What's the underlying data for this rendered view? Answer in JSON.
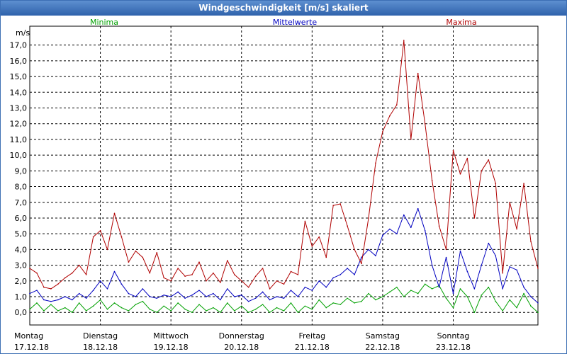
{
  "chart_data": {
    "type": "line",
    "title": "Windgeschwindigkeit [m/s] skaliert",
    "ylabel": "m/s",
    "ylim": [
      -0.8,
      18.2
    ],
    "yticks": [
      "0,0",
      "1,0",
      "2,0",
      "3,0",
      "4,0",
      "5,0",
      "6,0",
      "7,0",
      "8,0",
      "9,0",
      "10,0",
      "11,0",
      "12,0",
      "13,0",
      "14,0",
      "15,0",
      "16,0",
      "17,0"
    ],
    "xlim": [
      0,
      7.2
    ],
    "xticks": [
      {
        "day": "Montag",
        "date": "17.12.18"
      },
      {
        "day": "Dienstag",
        "date": "18.12.18"
      },
      {
        "day": "Mittwoch",
        "date": "19.12.18"
      },
      {
        "day": "Donnerstag",
        "date": "20.12.18"
      },
      {
        "day": "Freitag",
        "date": "21.12.18"
      },
      {
        "day": "Samstag",
        "date": "22.12.18"
      },
      {
        "day": "Sonntag",
        "date": "23.12.18"
      }
    ],
    "grid": true,
    "legend": "top",
    "series": [
      {
        "name": "Minima",
        "color": "#00a000",
        "x": [
          0,
          0.1,
          0.2,
          0.3,
          0.4,
          0.5,
          0.6,
          0.7,
          0.8,
          0.9,
          1.0,
          1.1,
          1.2,
          1.3,
          1.4,
          1.5,
          1.6,
          1.7,
          1.8,
          1.9,
          2.0,
          2.1,
          2.2,
          2.3,
          2.4,
          2.5,
          2.6,
          2.7,
          2.8,
          2.9,
          3.0,
          3.1,
          3.2,
          3.3,
          3.4,
          3.5,
          3.6,
          3.7,
          3.8,
          3.9,
          4.0,
          4.1,
          4.2,
          4.3,
          4.4,
          4.5,
          4.6,
          4.7,
          4.8,
          4.9,
          5.0,
          5.1,
          5.2,
          5.3,
          5.4,
          5.5,
          5.6,
          5.7,
          5.8,
          5.9,
          6.0,
          6.1,
          6.2,
          6.3,
          6.4,
          6.5,
          6.6,
          6.7,
          6.8,
          6.9,
          7.0,
          7.1,
          7.2
        ],
        "values": [
          0.2,
          0.6,
          0.1,
          0.5,
          0.1,
          0.3,
          0,
          0.6,
          0.1,
          0.4,
          0.8,
          0.2,
          0.6,
          0.3,
          0.1,
          0.5,
          0.7,
          0.2,
          0,
          0.4,
          0.1,
          0.6,
          0.2,
          0,
          0.5,
          0.1,
          0.3,
          0,
          0.6,
          0.1,
          0.4,
          0,
          0.2,
          0.5,
          0,
          0.3,
          0.1,
          0.6,
          0,
          0.4,
          0.2,
          0.8,
          0.3,
          0.6,
          0.5,
          0.9,
          0.6,
          0.7,
          1.2,
          0.8,
          1.0,
          1.3,
          1.6,
          1.0,
          1.4,
          1.2,
          1.8,
          1.5,
          1.7,
          0.9,
          0.3,
          1.5,
          1.0,
          0,
          1.1,
          1.6,
          0.7,
          0.1,
          0.8,
          0.3,
          1.2,
          0.4,
          0
        ]
      },
      {
        "name": "Mittelwerte",
        "color": "#0000c0",
        "x": [
          0,
          0.1,
          0.2,
          0.3,
          0.4,
          0.5,
          0.6,
          0.7,
          0.8,
          0.9,
          1.0,
          1.1,
          1.2,
          1.3,
          1.4,
          1.5,
          1.6,
          1.7,
          1.8,
          1.9,
          2.0,
          2.1,
          2.2,
          2.3,
          2.4,
          2.5,
          2.6,
          2.7,
          2.8,
          2.9,
          3.0,
          3.1,
          3.2,
          3.3,
          3.4,
          3.5,
          3.6,
          3.7,
          3.8,
          3.9,
          4.0,
          4.1,
          4.2,
          4.3,
          4.4,
          4.5,
          4.6,
          4.7,
          4.8,
          4.9,
          5.0,
          5.1,
          5.2,
          5.3,
          5.4,
          5.5,
          5.6,
          5.7,
          5.8,
          5.9,
          6.0,
          6.1,
          6.2,
          6.3,
          6.4,
          6.5,
          6.6,
          6.7,
          6.8,
          6.9,
          7.0,
          7.1,
          7.2
        ],
        "values": [
          1.2,
          1.4,
          0.8,
          0.7,
          0.8,
          1.0,
          0.8,
          1.2,
          0.9,
          1.4,
          2.0,
          1.5,
          2.6,
          1.8,
          1.2,
          1.0,
          1.5,
          1.0,
          0.9,
          1.1,
          1.0,
          1.3,
          0.9,
          1.1,
          1.4,
          1.0,
          1.2,
          0.8,
          1.5,
          1.0,
          1.1,
          0.7,
          0.9,
          1.3,
          0.8,
          1.0,
          0.9,
          1.4,
          1.0,
          1.6,
          1.4,
          2.0,
          1.6,
          2.2,
          2.4,
          2.8,
          2.4,
          3.5,
          4.0,
          3.6,
          4.9,
          5.3,
          5.0,
          6.2,
          5.4,
          6.6,
          5.2,
          3.0,
          1.6,
          3.5,
          1.2,
          3.9,
          2.6,
          1.5,
          3.0,
          4.4,
          3.6,
          1.5,
          2.9,
          2.7,
          1.6,
          1.0,
          0.6
        ]
      },
      {
        "name": "Maxima",
        "color": "#b00000",
        "x": [
          0,
          0.1,
          0.2,
          0.3,
          0.4,
          0.5,
          0.6,
          0.7,
          0.8,
          0.9,
          1.0,
          1.1,
          1.2,
          1.3,
          1.4,
          1.5,
          1.6,
          1.7,
          1.8,
          1.9,
          2.0,
          2.1,
          2.2,
          2.3,
          2.4,
          2.5,
          2.6,
          2.7,
          2.8,
          2.9,
          3.0,
          3.1,
          3.2,
          3.3,
          3.4,
          3.5,
          3.6,
          3.7,
          3.8,
          3.9,
          4.0,
          4.1,
          4.2,
          4.3,
          4.4,
          4.5,
          4.6,
          4.7,
          4.8,
          4.9,
          5.0,
          5.1,
          5.2,
          5.3,
          5.4,
          5.5,
          5.6,
          5.7,
          5.8,
          5.9,
          6.0,
          6.1,
          6.2,
          6.3,
          6.4,
          6.5,
          6.6,
          6.7,
          6.8,
          6.9,
          7.0,
          7.1,
          7.2
        ],
        "values": [
          2.8,
          2.5,
          1.6,
          1.5,
          1.8,
          2.2,
          2.5,
          3.0,
          2.4,
          4.8,
          5.2,
          4.0,
          6.3,
          4.8,
          3.2,
          3.9,
          3.5,
          2.5,
          3.8,
          2.2,
          2.0,
          2.8,
          2.3,
          2.4,
          3.2,
          2.0,
          2.5,
          1.9,
          3.3,
          2.4,
          2.0,
          1.6,
          2.3,
          2.8,
          1.5,
          2.0,
          1.8,
          2.6,
          2.4,
          5.8,
          4.2,
          4.8,
          3.5,
          6.8,
          6.9,
          5.5,
          4.0,
          3.1,
          6.0,
          9.5,
          11.5,
          12.5,
          13.2,
          17.3,
          11.0,
          15.2,
          12.0,
          8.4,
          5.5,
          4.0,
          10.3,
          8.8,
          9.8,
          6.0,
          9.0,
          9.7,
          8.2,
          2.5,
          7.0,
          5.3,
          8.2,
          4.5,
          2.8
        ]
      }
    ]
  }
}
